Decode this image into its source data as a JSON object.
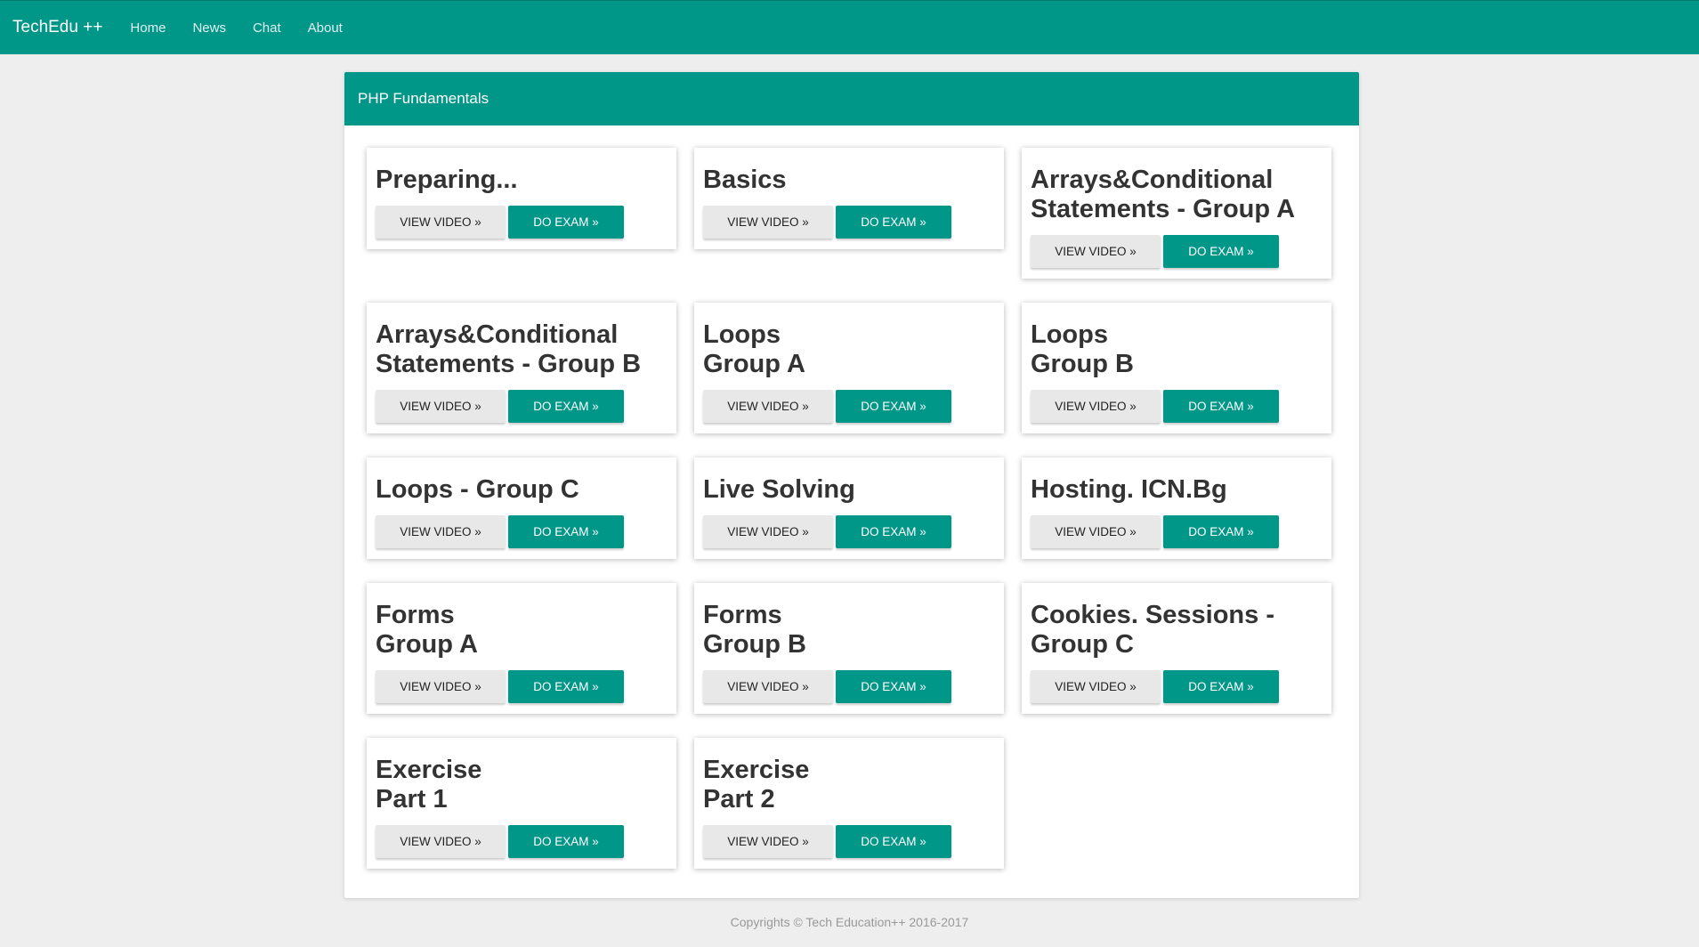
{
  "nav": {
    "brand": "TechEdu ++",
    "links": [
      "Home",
      "News",
      "Chat",
      "About"
    ]
  },
  "panel": {
    "title": "PHP Fundamentals"
  },
  "buttons": {
    "video": "VIEW VIDEO »",
    "exam": "DO EXAM »"
  },
  "courses": [
    {
      "title": "Preparing..."
    },
    {
      "title": "Basics"
    },
    {
      "title": "Arrays&Conditional\nStatements - Group A"
    },
    {
      "title": "Arrays&Conditional\nStatements - Group B"
    },
    {
      "title": "Loops\nGroup A"
    },
    {
      "title": "Loops\nGroup B"
    },
    {
      "title": "Loops - Group C"
    },
    {
      "title": "Live Solving"
    },
    {
      "title": "Hosting. ICN.Bg"
    },
    {
      "title": "Forms\nGroup A"
    },
    {
      "title": "Forms\nGroup B"
    },
    {
      "title": "Cookies. Sessions -\nGroup C"
    },
    {
      "title": "Exercise\nPart 1"
    },
    {
      "title": "Exercise\nPart 2"
    }
  ],
  "footer": {
    "text": "Copyrights © Tech Education++ 2016-2017"
  },
  "colors": {
    "primary": "#009688",
    "background": "#eeeeee"
  }
}
